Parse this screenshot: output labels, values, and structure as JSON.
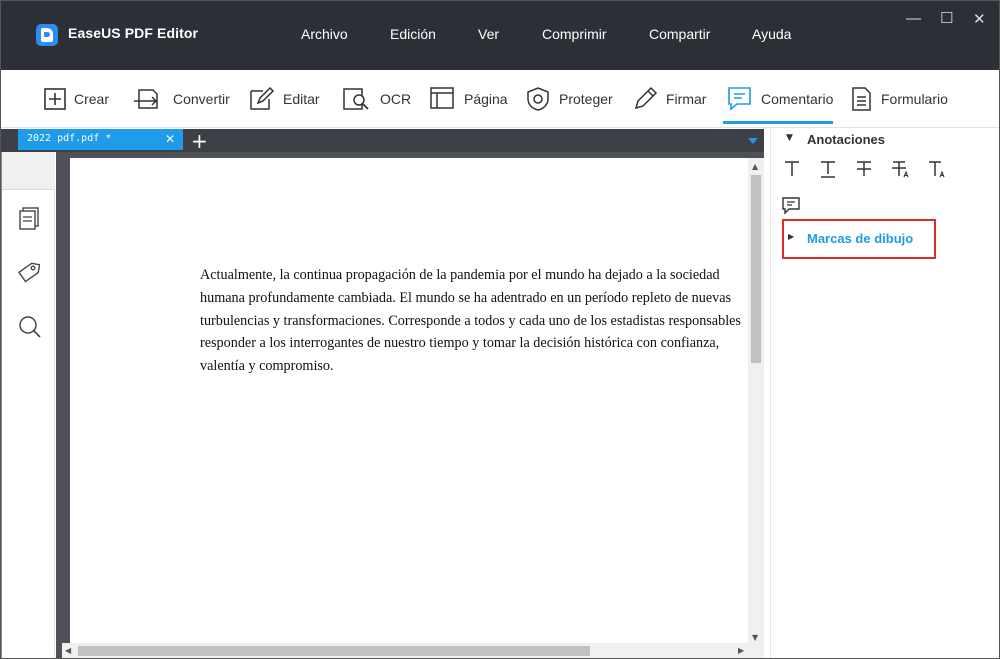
{
  "app": {
    "title": "EaseUS PDF Editor",
    "accent_color": "#1e9be9",
    "titlebar_color": "#2c2f36"
  },
  "menu": [
    "Archivo",
    "Edición",
    "Ver",
    "Comprimir",
    "Compartir",
    "Ayuda"
  ],
  "window_controls": {
    "minimize": "—",
    "maximize": "☐",
    "close": "✕"
  },
  "toolbar": {
    "items": [
      {
        "label": "Crear",
        "icon": "plus-square-icon"
      },
      {
        "label": "Convertir",
        "icon": "convert-icon"
      },
      {
        "label": "Editar",
        "icon": "edit-icon"
      },
      {
        "label": "OCR",
        "icon": "ocr-icon"
      },
      {
        "label": "Página",
        "icon": "page-icon"
      },
      {
        "label": "Proteger",
        "icon": "shield-icon"
      },
      {
        "label": "Firmar",
        "icon": "pen-icon"
      },
      {
        "label": "Comentario",
        "icon": "comment-icon",
        "active": true
      },
      {
        "label": "Formulario",
        "icon": "form-icon"
      }
    ]
  },
  "tabs": {
    "active_tab": "2022 pdf.pdf *",
    "close_symbol": "✕",
    "add_symbol": "+"
  },
  "sidebar": {
    "icons": [
      "thumbnails-icon",
      "tag-icon",
      "search-icon"
    ]
  },
  "document": {
    "lines": [
      "Actualmente, la continua propagación de la pandemia por el mundo ha dejado a la sociedad",
      "humana profundamente cambiada. El mundo se ha adentrado en un período repleto de nuevas",
      "turbulencias y transformaciones. Corresponde a todos y cada uno de los estadistas responsables",
      "responder a los interrogantes de nuestro tiempo y tomar la decisión histórica con confianza,",
      "valentía y compromiso."
    ]
  },
  "right_panel": {
    "annotations_heading": "Anotaciones",
    "annotation_tools": [
      "text-icon",
      "underline-text-icon",
      "strikethrough-text-icon",
      "replace-text-icon",
      "insert-text-icon"
    ],
    "note_tool": "note-comment-icon",
    "drawing_marks_label": "Marcas de dibujo"
  }
}
